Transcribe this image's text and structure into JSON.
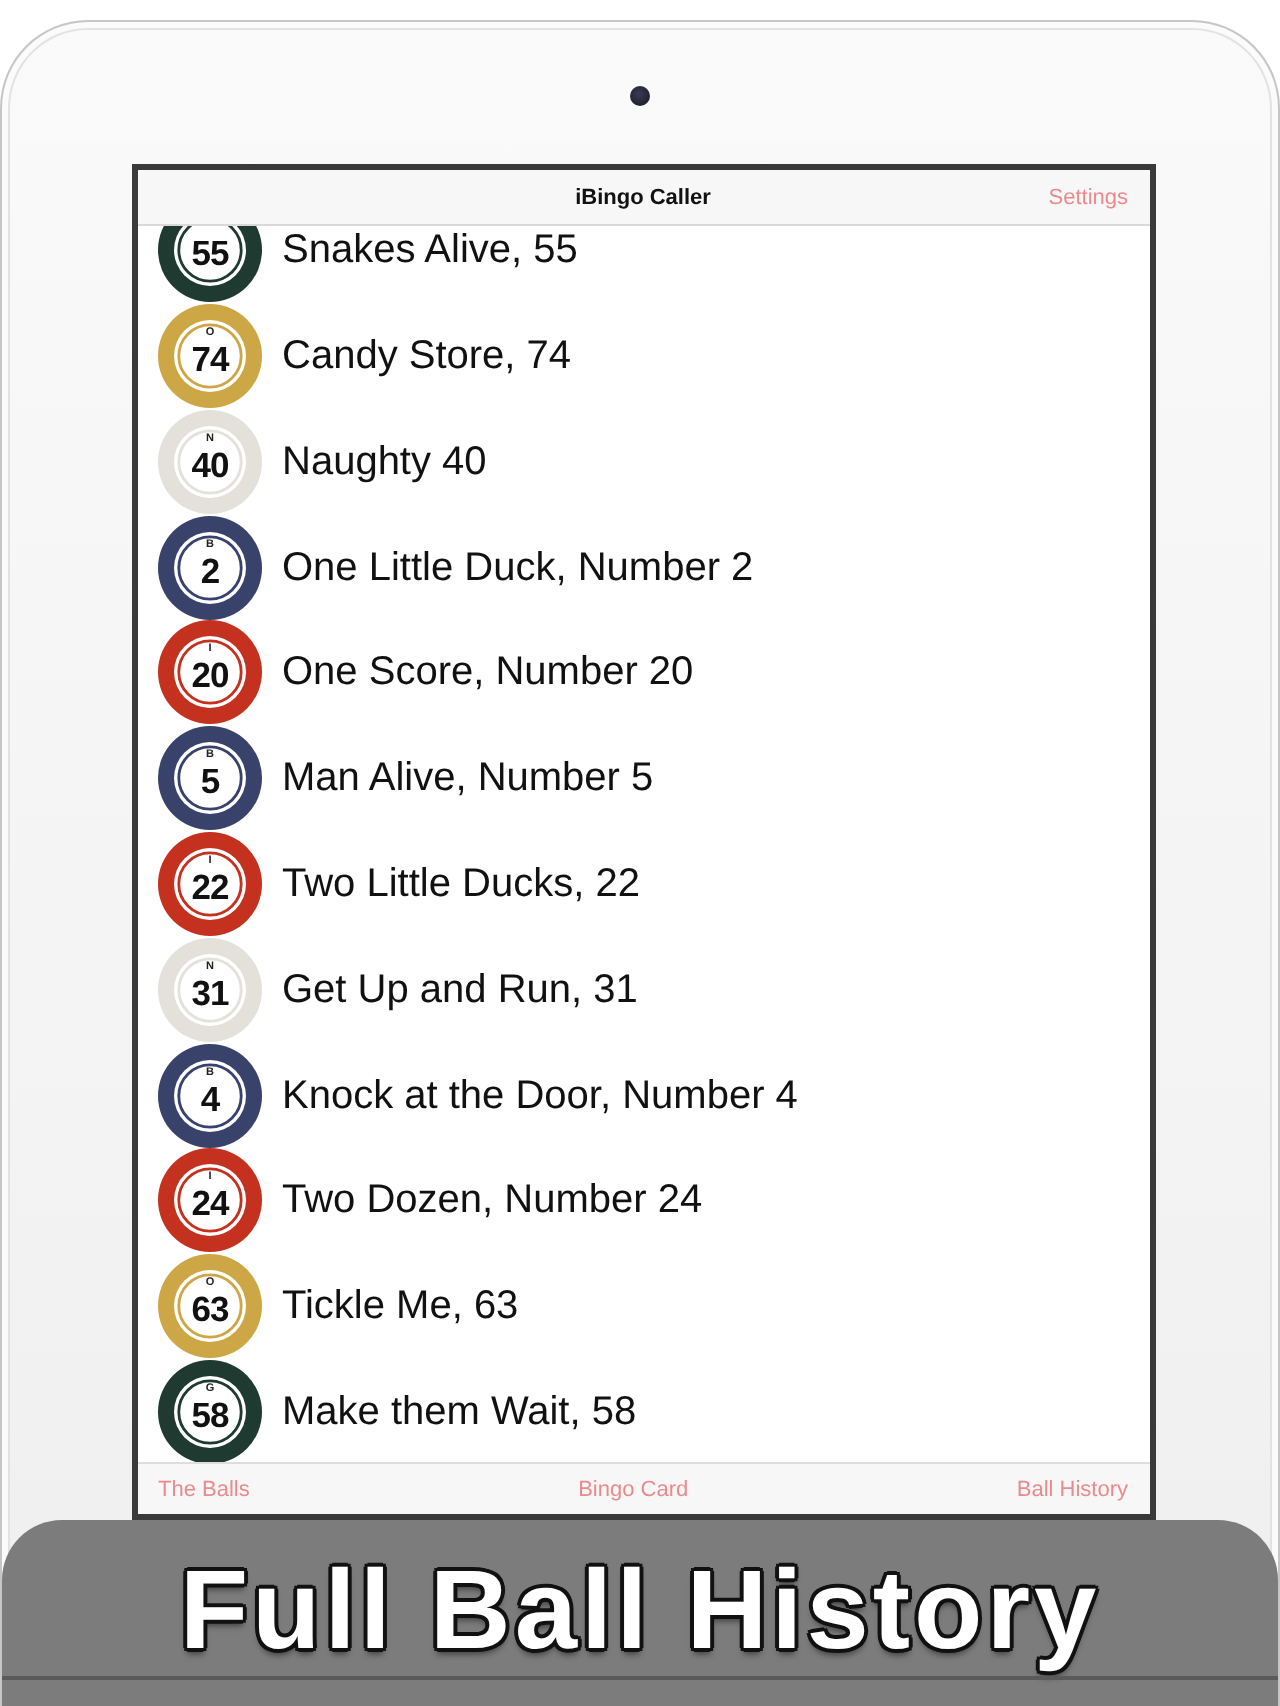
{
  "nav_bar": {
    "title": "iBingo Caller",
    "right_button": "Settings"
  },
  "calls": [
    {
      "number": "55",
      "phrase": "Snakes Alive, 55",
      "color": "#1f3a30"
    },
    {
      "letter": "O",
      "number": "74",
      "phrase": "Candy Store, 74",
      "color": "#cda745"
    },
    {
      "letter": "N",
      "number": "40",
      "phrase": "Naughty 40",
      "color": "#e4e1da"
    },
    {
      "letter": "B",
      "number": "2",
      "phrase": "One Little Duck, Number 2",
      "color": "#38426a"
    },
    {
      "letter": "I",
      "number": "20",
      "phrase": "One Score, Number 20",
      "color": "#c4311f"
    },
    {
      "letter": "B",
      "number": "5",
      "phrase": "Man Alive, Number 5",
      "color": "#38426a"
    },
    {
      "letter": "I",
      "number": "22",
      "phrase": "Two Little Ducks, 22",
      "color": "#c4311f"
    },
    {
      "letter": "N",
      "number": "31",
      "phrase": "Get Up and Run, 31",
      "color": "#e4e1da"
    },
    {
      "letter": "B",
      "number": "4",
      "phrase": "Knock at the Door, Number 4",
      "color": "#38426a"
    },
    {
      "letter": "I",
      "number": "24",
      "phrase": "Two Dozen, Number 24",
      "color": "#c4311f"
    },
    {
      "letter": "O",
      "number": "63",
      "phrase": "Tickle Me, 63",
      "color": "#cda745"
    },
    {
      "letter": "G",
      "number": "58",
      "phrase": "Make them Wait, 58",
      "color": "#1f3a30"
    }
  ],
  "tab_bar": {
    "items": [
      {
        "label": "The Balls"
      },
      {
        "label": "Bingo Card"
      },
      {
        "label": "Ball History"
      }
    ]
  },
  "banner": {
    "text": "Full Ball History"
  }
}
